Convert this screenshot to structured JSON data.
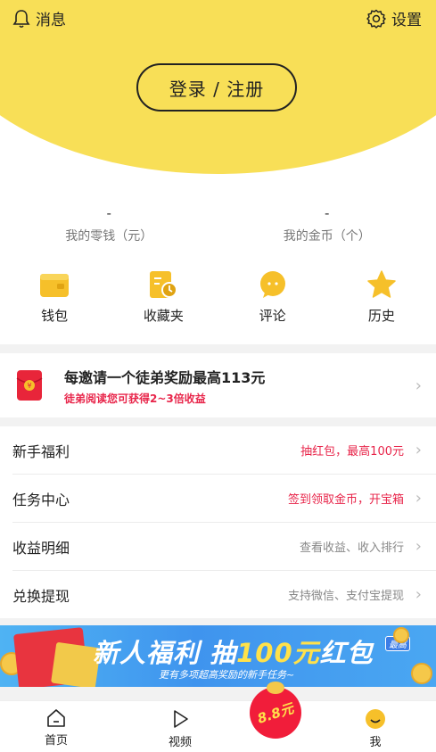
{
  "header": {
    "messages_label": "消息",
    "settings_label": "设置",
    "login_label": "登录 / 注册"
  },
  "stats": [
    {
      "value": "-",
      "label": "我的零钱（元）"
    },
    {
      "value": "-",
      "label": "我的金币（个）"
    }
  ],
  "quick_links": [
    {
      "label": "钱包",
      "icon": "wallet-icon"
    },
    {
      "label": "收藏夹",
      "icon": "favorites-icon"
    },
    {
      "label": "评论",
      "icon": "comment-icon"
    },
    {
      "label": "历史",
      "icon": "history-star-icon"
    }
  ],
  "invite": {
    "title": "每邀请一个徒弟奖励最高113元",
    "subtitle": "徒弟阅读您可获得2~3倍收益"
  },
  "menu": [
    {
      "label": "新手福利",
      "detail": "抽红包，最高100元",
      "detail_color": "#e8254a"
    },
    {
      "label": "任务中心",
      "detail": "签到领取金币，开宝箱",
      "detail_color": "#e8254a"
    },
    {
      "label": "收益明细",
      "detail": "查看收益、收入排行",
      "detail_color": "#888888"
    },
    {
      "label": "兑换提现",
      "detail": "支持微信、支付宝提现",
      "detail_color": "#888888"
    }
  ],
  "banner": {
    "title_part1": "新人福利 抽",
    "title_highlight": "100元",
    "title_part2": "红包",
    "tag": "最高",
    "subtitle": "更有多项超高奖励的新手任务~"
  },
  "tabbar": {
    "home": "首页",
    "video": "视频",
    "red_packet": "8.8元",
    "me": "我"
  },
  "colors": {
    "accent_yellow": "#f8df57",
    "accent_red": "#e8254a",
    "banner_blue": "#3f94ee"
  }
}
